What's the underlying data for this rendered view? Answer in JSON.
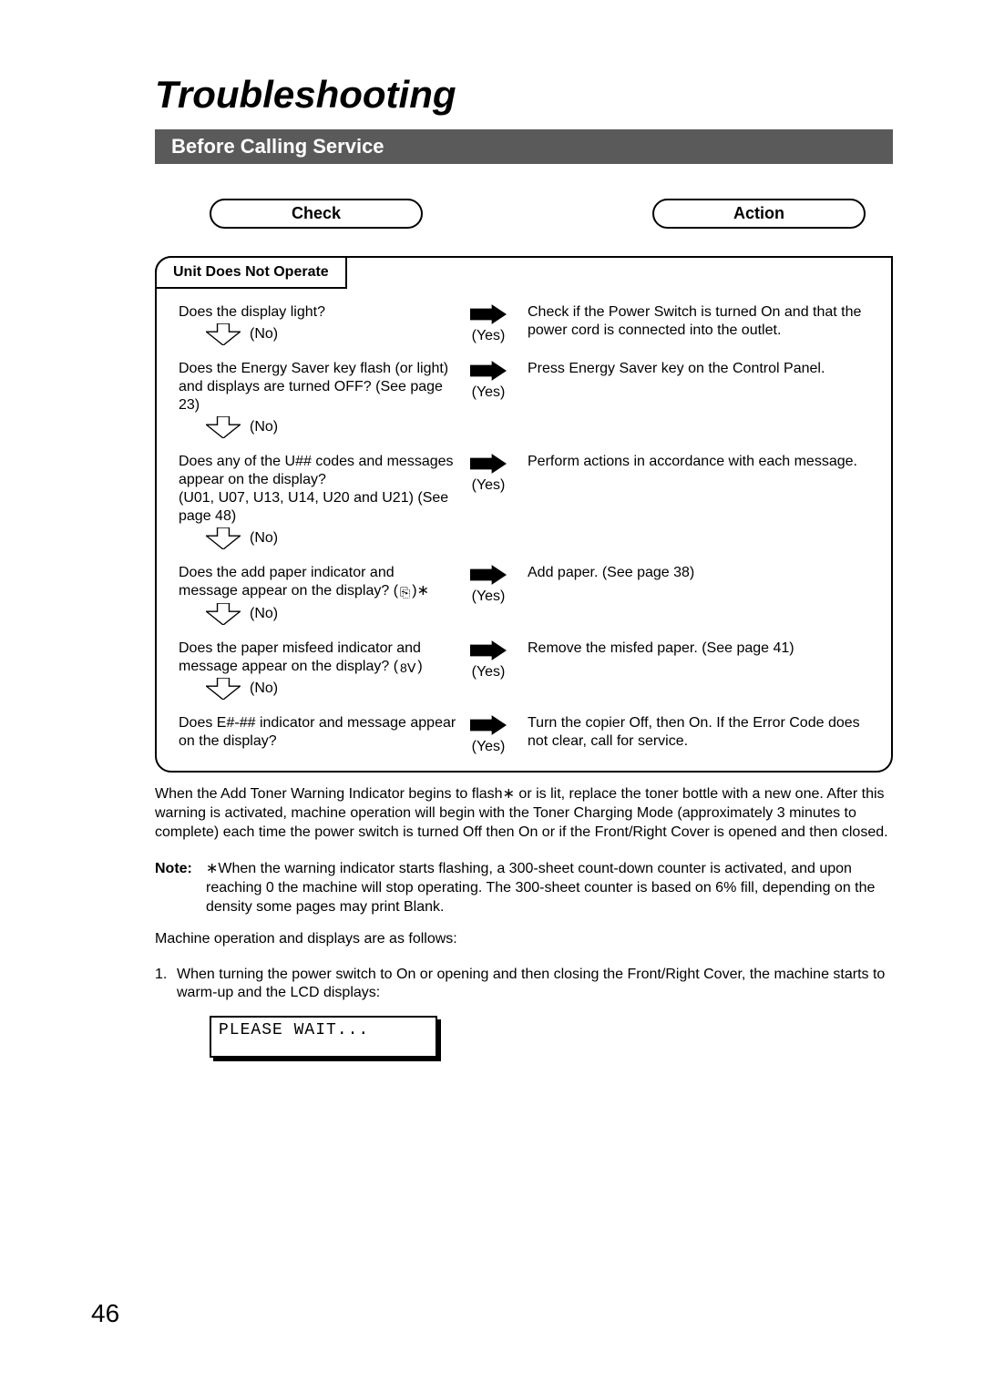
{
  "title": "Troubleshooting",
  "section": "Before Calling Service",
  "headers": {
    "check": "Check",
    "action": "Action"
  },
  "tab_label": "Unit Does Not Operate",
  "labels": {
    "no": "(No)",
    "yes": "(Yes)"
  },
  "steps": [
    {
      "check": "Does the display light?",
      "action": "Check if the Power Switch is turned On and that the power cord is connected into the outlet.",
      "show_no": true
    },
    {
      "check": "Does the Energy Saver key flash (or light) and displays are turned OFF? (See page 23)",
      "action": "Press Energy Saver key on the Control Panel.",
      "show_no": true
    },
    {
      "check": "Does any of the U## codes and messages appear on the display?\n(U01, U07, U13, U14, U20 and U21) (See page 48)",
      "action": "Perform actions in accordance with each message.",
      "show_no": true
    },
    {
      "check": "Does the add paper indicator and message appear on the display? ( )∗",
      "action": "Add paper. (See page 38)",
      "show_no": true,
      "icon": "add-paper"
    },
    {
      "check": "Does the paper misfeed indicator and message appear on the display? ( )",
      "action": "Remove the misfed paper. (See page 41)",
      "show_no": true,
      "icon": "misfeed"
    },
    {
      "check": "Does E#-## indicator and message appear on the display?",
      "action": "Turn the copier Off, then On. If the Error Code does not clear, call for service.",
      "show_no": false
    }
  ],
  "para1": "When the Add Toner Warning Indicator begins to flash∗ or is lit, replace the toner bottle with a new one.  After this warning is activated, machine operation will begin with the Toner Charging Mode (approximately 3 minutes to complete) each time the power switch is turned Off then On or if the Front/Right Cover is opened and then closed.",
  "note_label": "Note:",
  "note_body": "∗When the warning indicator starts flashing, a 300-sheet count-down counter is activated, and upon reaching 0 the machine will stop operating.  The 300-sheet counter is based on 6% fill, depending on the density some pages may print Blank.",
  "para2": "Machine operation and displays are as follows:",
  "list1_num": "1.",
  "list1_body": "When turning the power switch to On or opening and then closing the Front/Right Cover, the machine starts to warm-up and the LCD displays:",
  "lcd_text": "PLEASE WAIT...",
  "page_number": "46"
}
